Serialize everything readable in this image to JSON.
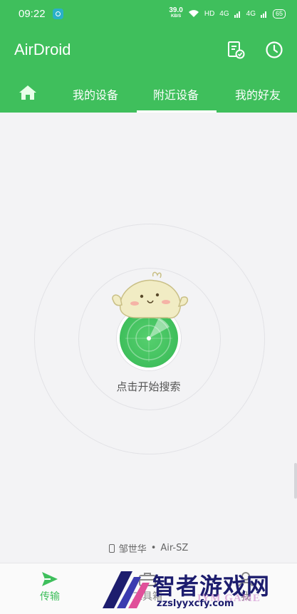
{
  "status_bar": {
    "time": "09:22",
    "net_speed": "39.0",
    "net_unit": "KB/S",
    "hd": "HD",
    "sim1": "4G",
    "sim2": "4G",
    "battery": "65"
  },
  "app_bar": {
    "title": "AirDroid",
    "actions": [
      "document-check-icon",
      "clock-icon"
    ]
  },
  "tabs": {
    "home_icon": "home-icon",
    "items": [
      {
        "label": "我的设备",
        "active": false
      },
      {
        "label": "附近设备",
        "active": true
      },
      {
        "label": "我的好友",
        "active": false
      }
    ]
  },
  "radar": {
    "label": "点击开始搜索"
  },
  "device": {
    "owner": "邹世华",
    "separator": "•",
    "name": "Air-SZ"
  },
  "bottom_nav": {
    "items": [
      {
        "label": "传输",
        "icon": "send-icon",
        "active": true
      },
      {
        "label": "工具箱",
        "icon": "toolbox-icon",
        "active": false
      },
      {
        "label": "我",
        "icon": "user-icon",
        "active": false
      }
    ]
  },
  "watermark": {
    "main": "智者游戏网",
    "sub": "zzslyyxcfy.com",
    "ghost": "JYM GAME"
  },
  "colors": {
    "accent": "#3fbf5c",
    "background": "#f3f3f5"
  }
}
